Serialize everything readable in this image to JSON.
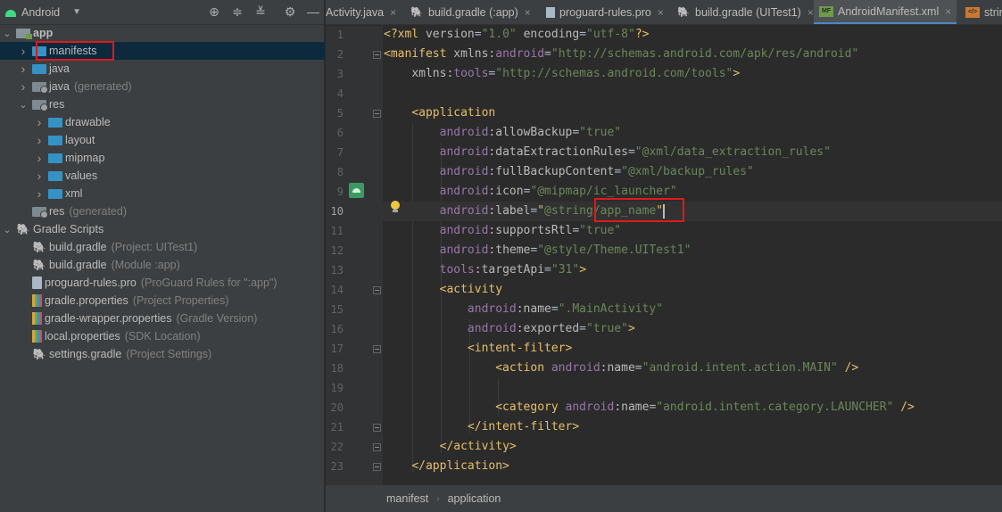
{
  "project_panel": {
    "view_label": "Android",
    "toolbar_icons": [
      "locate-icon",
      "expand-all-icon",
      "collapse-all-icon",
      "gear-icon",
      "minimize-icon"
    ],
    "tree": [
      {
        "label": "app",
        "detail": "",
        "depth": 0,
        "expanded": true,
        "icon": "app-module-folder-icon",
        "bold": true
      },
      {
        "label": "manifests",
        "detail": "",
        "depth": 1,
        "expanded": false,
        "icon": "folder-icon",
        "selected": true
      },
      {
        "label": "java",
        "detail": "",
        "depth": 1,
        "expanded": false,
        "icon": "folder-icon"
      },
      {
        "label": "java",
        "detail": "(generated)",
        "depth": 1,
        "expanded": false,
        "icon": "generated-folder-icon"
      },
      {
        "label": "res",
        "detail": "",
        "depth": 1,
        "expanded": true,
        "icon": "resources-folder-icon"
      },
      {
        "label": "drawable",
        "detail": "",
        "depth": 2,
        "expanded": false,
        "icon": "folder-icon"
      },
      {
        "label": "layout",
        "detail": "",
        "depth": 2,
        "expanded": false,
        "icon": "folder-icon"
      },
      {
        "label": "mipmap",
        "detail": "",
        "depth": 2,
        "expanded": false,
        "icon": "folder-icon"
      },
      {
        "label": "values",
        "detail": "",
        "depth": 2,
        "expanded": false,
        "icon": "folder-icon"
      },
      {
        "label": "xml",
        "detail": "",
        "depth": 2,
        "expanded": false,
        "icon": "folder-icon"
      },
      {
        "label": "res",
        "detail": "(generated)",
        "depth": 1,
        "expanded": null,
        "icon": "generated-folder-icon"
      },
      {
        "label": "Gradle Scripts",
        "detail": "",
        "depth": 0,
        "expanded": true,
        "icon": "gradle-icon"
      },
      {
        "label": "build.gradle",
        "detail": "(Project: UITest1)",
        "depth": 1,
        "expanded": null,
        "icon": "gradle-icon"
      },
      {
        "label": "build.gradle",
        "detail": "(Module :app)",
        "depth": 1,
        "expanded": null,
        "icon": "gradle-icon"
      },
      {
        "label": "proguard-rules.pro",
        "detail": "(ProGuard Rules for \":app\")",
        "depth": 1,
        "expanded": null,
        "icon": "text-file-icon"
      },
      {
        "label": "gradle.properties",
        "detail": "(Project Properties)",
        "depth": 1,
        "expanded": null,
        "icon": "properties-file-icon"
      },
      {
        "label": "gradle-wrapper.properties",
        "detail": "(Gradle Version)",
        "depth": 1,
        "expanded": null,
        "icon": "properties-file-icon"
      },
      {
        "label": "local.properties",
        "detail": "(SDK Location)",
        "depth": 1,
        "expanded": null,
        "icon": "properties-file-icon"
      },
      {
        "label": "settings.gradle",
        "detail": "(Project Settings)",
        "depth": 1,
        "expanded": null,
        "icon": "gradle-icon"
      }
    ]
  },
  "tabs": [
    {
      "label": "Activity.java",
      "icon": "java-class-icon",
      "active": false
    },
    {
      "label": "build.gradle (:app)",
      "icon": "gradle-icon",
      "active": false
    },
    {
      "label": "proguard-rules.pro",
      "icon": "text-file-icon",
      "active": false
    },
    {
      "label": "build.gradle (UITest1)",
      "icon": "gradle-icon",
      "active": false
    },
    {
      "label": "AndroidManifest.xml",
      "icon": "manifest-file-icon",
      "icon_text": "MF",
      "active": true
    },
    {
      "label": "strin",
      "icon": "strings-xml-icon",
      "icon_text": "</>",
      "active": false
    }
  ],
  "editor": {
    "current_line": 10,
    "line_numbers": [
      "1",
      "2",
      "3",
      "4",
      "5",
      "6",
      "7",
      "8",
      "9",
      "10",
      "11",
      "12",
      "13",
      "14",
      "15",
      "16",
      "17",
      "18",
      "19",
      "20",
      "21",
      "22",
      "23"
    ],
    "lines": [
      [
        {
          "c": "t",
          "s": "<?xml "
        },
        {
          "c": "at",
          "s": "version"
        },
        {
          "c": "pl",
          "s": "="
        },
        {
          "c": "v",
          "s": "\"1.0\""
        },
        {
          "c": "pl",
          "s": " "
        },
        {
          "c": "at",
          "s": "encoding"
        },
        {
          "c": "pl",
          "s": "="
        },
        {
          "c": "v",
          "s": "\"utf-8\""
        },
        {
          "c": "t",
          "s": "?>"
        }
      ],
      [
        {
          "c": "t",
          "s": "<manifest "
        },
        {
          "c": "at",
          "s": "xmlns:"
        },
        {
          "c": "ns",
          "s": "android"
        },
        {
          "c": "pl",
          "s": "="
        },
        {
          "c": "v",
          "s": "\"http://schemas.android.com/apk/res/android\""
        }
      ],
      [
        {
          "c": "pl",
          "s": "    "
        },
        {
          "c": "at",
          "s": "xmlns:"
        },
        {
          "c": "ns",
          "s": "tools"
        },
        {
          "c": "pl",
          "s": "="
        },
        {
          "c": "v",
          "s": "\"http://schemas.android.com/tools\""
        },
        {
          "c": "t",
          "s": ">"
        }
      ],
      [
        {
          "c": "pl",
          "s": ""
        }
      ],
      [
        {
          "c": "pl",
          "s": "    "
        },
        {
          "c": "t",
          "s": "<application"
        }
      ],
      [
        {
          "c": "pl",
          "s": "        "
        },
        {
          "c": "ns",
          "s": "android"
        },
        {
          "c": "at",
          "s": ":allowBackup"
        },
        {
          "c": "pl",
          "s": "="
        },
        {
          "c": "v",
          "s": "\"true\""
        }
      ],
      [
        {
          "c": "pl",
          "s": "        "
        },
        {
          "c": "ns",
          "s": "android"
        },
        {
          "c": "at",
          "s": ":dataExtractionRules"
        },
        {
          "c": "pl",
          "s": "="
        },
        {
          "c": "v",
          "s": "\"@xml/data_extraction_rules\""
        }
      ],
      [
        {
          "c": "pl",
          "s": "        "
        },
        {
          "c": "ns",
          "s": "android"
        },
        {
          "c": "at",
          "s": ":fullBackupContent"
        },
        {
          "c": "pl",
          "s": "="
        },
        {
          "c": "v",
          "s": "\"@xml/backup_rules\""
        }
      ],
      [
        {
          "c": "pl",
          "s": "        "
        },
        {
          "c": "ns",
          "s": "android"
        },
        {
          "c": "at",
          "s": ":icon"
        },
        {
          "c": "pl",
          "s": "="
        },
        {
          "c": "v",
          "s": "\"@mipmap/ic_launcher\""
        }
      ],
      [
        {
          "c": "pl",
          "s": "        "
        },
        {
          "c": "ns",
          "s": "android"
        },
        {
          "c": "at",
          "s": ":label"
        },
        {
          "c": "pl",
          "s": "="
        },
        {
          "c": "q",
          "s": "\""
        },
        {
          "c": "v",
          "s": "@string/app_name"
        },
        {
          "c": "q",
          "s": "\""
        },
        {
          "c": "caret",
          "s": ""
        }
      ],
      [
        {
          "c": "pl",
          "s": "        "
        },
        {
          "c": "ns",
          "s": "android"
        },
        {
          "c": "at",
          "s": ":supportsRtl"
        },
        {
          "c": "pl",
          "s": "="
        },
        {
          "c": "v",
          "s": "\"true\""
        }
      ],
      [
        {
          "c": "pl",
          "s": "        "
        },
        {
          "c": "ns",
          "s": "android"
        },
        {
          "c": "at",
          "s": ":theme"
        },
        {
          "c": "pl",
          "s": "="
        },
        {
          "c": "v",
          "s": "\"@style/Theme.UITest1\""
        }
      ],
      [
        {
          "c": "pl",
          "s": "        "
        },
        {
          "c": "ns",
          "s": "tools"
        },
        {
          "c": "at",
          "s": ":targetApi"
        },
        {
          "c": "pl",
          "s": "="
        },
        {
          "c": "v",
          "s": "\"31\""
        },
        {
          "c": "t",
          "s": ">"
        }
      ],
      [
        {
          "c": "pl",
          "s": "        "
        },
        {
          "c": "t",
          "s": "<activity"
        }
      ],
      [
        {
          "c": "pl",
          "s": "            "
        },
        {
          "c": "ns",
          "s": "android"
        },
        {
          "c": "at",
          "s": ":name"
        },
        {
          "c": "pl",
          "s": "="
        },
        {
          "c": "v",
          "s": "\".MainActivity\""
        }
      ],
      [
        {
          "c": "pl",
          "s": "            "
        },
        {
          "c": "ns",
          "s": "android"
        },
        {
          "c": "at",
          "s": ":exported"
        },
        {
          "c": "pl",
          "s": "="
        },
        {
          "c": "v",
          "s": "\"true\""
        },
        {
          "c": "t",
          "s": ">"
        }
      ],
      [
        {
          "c": "pl",
          "s": "            "
        },
        {
          "c": "t",
          "s": "<intent-filter>"
        }
      ],
      [
        {
          "c": "pl",
          "s": "                "
        },
        {
          "c": "t",
          "s": "<action "
        },
        {
          "c": "ns",
          "s": "android"
        },
        {
          "c": "at",
          "s": ":name"
        },
        {
          "c": "pl",
          "s": "="
        },
        {
          "c": "v",
          "s": "\"android.intent.action.MAIN\""
        },
        {
          "c": "pl",
          "s": " "
        },
        {
          "c": "t",
          "s": "/>"
        }
      ],
      [
        {
          "c": "pl",
          "s": ""
        }
      ],
      [
        {
          "c": "pl",
          "s": "                "
        },
        {
          "c": "t",
          "s": "<category "
        },
        {
          "c": "ns",
          "s": "android"
        },
        {
          "c": "at",
          "s": ":name"
        },
        {
          "c": "pl",
          "s": "="
        },
        {
          "c": "v",
          "s": "\"android.intent.category.LAUNCHER\""
        },
        {
          "c": "pl",
          "s": " "
        },
        {
          "c": "t",
          "s": "/>"
        }
      ],
      [
        {
          "c": "pl",
          "s": "            "
        },
        {
          "c": "t",
          "s": "</intent-filter>"
        }
      ],
      [
        {
          "c": "pl",
          "s": "        "
        },
        {
          "c": "t",
          "s": "</activity>"
        }
      ],
      [
        {
          "c": "pl",
          "s": "    "
        },
        {
          "c": "t",
          "s": "</application>"
        }
      ]
    ]
  },
  "breadcrumb": [
    "manifest",
    "application"
  ],
  "colors": {
    "editor_bg": "#2b2b2b",
    "panel_bg": "#3c3f41",
    "selection": "#0d293e",
    "tag": "#e8bf6a",
    "attribute_namespace": "#9876aa",
    "string_value": "#6a8759",
    "highlight_box": "#e01919",
    "active_tab_underline": "#4a88c7"
  }
}
